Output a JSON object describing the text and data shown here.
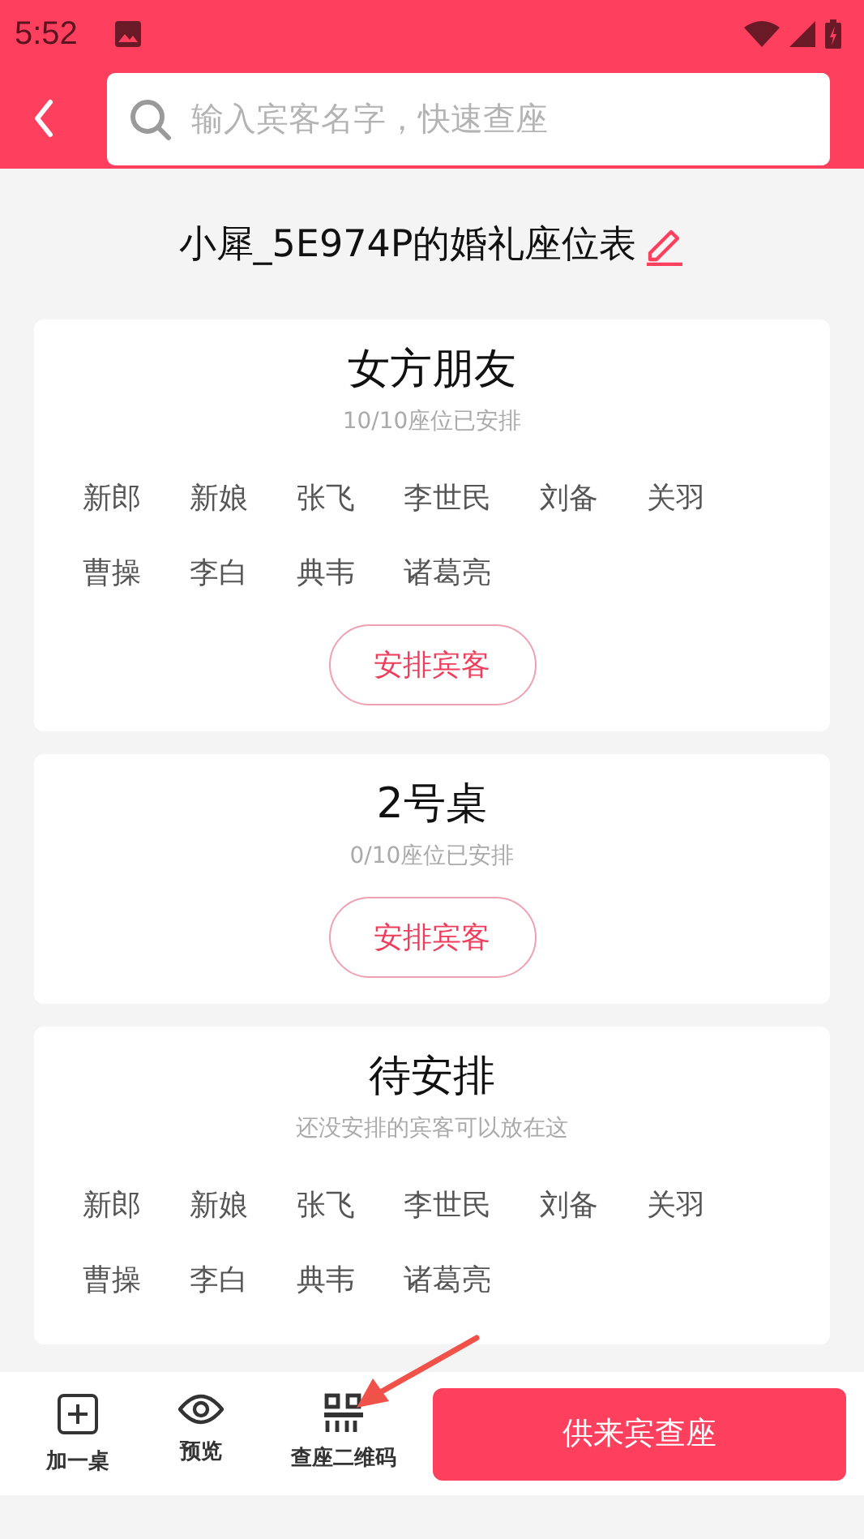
{
  "status_bar": {
    "time": "5:52"
  },
  "header": {
    "search": {
      "placeholder": "输入宾客名字，快速查座"
    }
  },
  "title": "小犀_5E974P的婚礼座位表",
  "tables": [
    {
      "name": "女方朋友",
      "subtitle": "10/10座位已安排",
      "guests": [
        "新郎",
        "新娘",
        "张飞",
        "李世民",
        "刘备",
        "关羽",
        "曹操",
        "李白",
        "典韦",
        "诸葛亮"
      ],
      "button": "安排宾客"
    },
    {
      "name": "2号桌",
      "subtitle": "0/10座位已安排",
      "button": "安排宾客"
    },
    {
      "name": "待安排",
      "subtitle": "还没安排的宾客可以放在这",
      "guests": [
        "新郎",
        "新娘",
        "张飞",
        "李世民",
        "刘备",
        "关羽",
        "曹操",
        "李白",
        "典韦",
        "诸葛亮"
      ]
    }
  ],
  "bottom_bar": {
    "actions": [
      {
        "kind": "add",
        "label": "加一桌"
      },
      {
        "kind": "eye",
        "label": "预览"
      },
      {
        "kind": "qr",
        "label": "查座二维码"
      }
    ],
    "primary_button": "供来宾查座"
  }
}
